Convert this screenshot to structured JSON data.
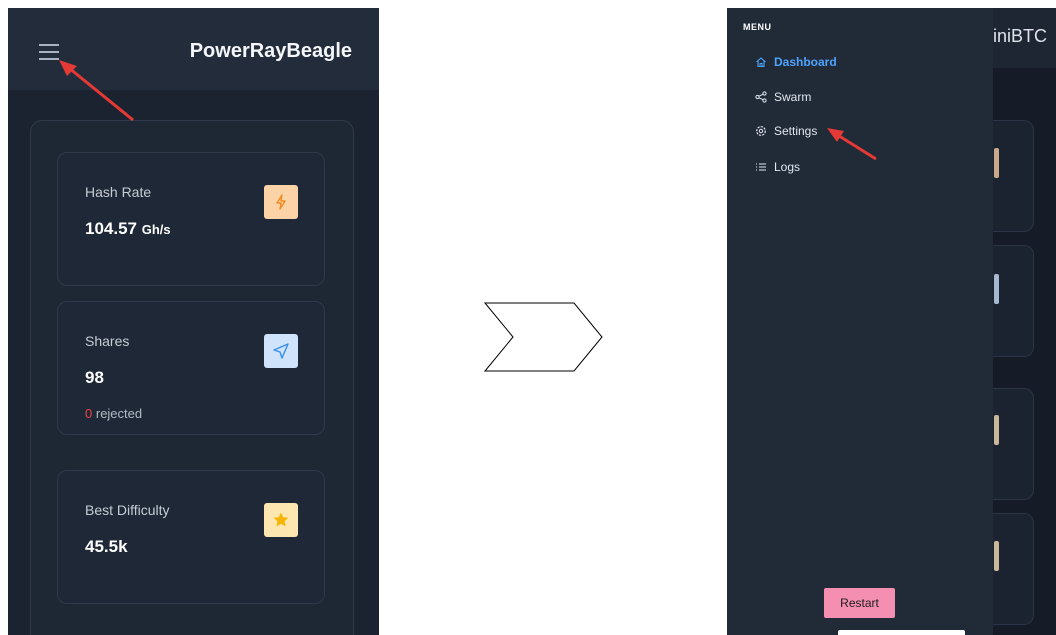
{
  "left_screen": {
    "app_title": "PowerRayBeagle",
    "cards": [
      {
        "label": "Hash Rate",
        "value": "104.57",
        "unit": "Gh/s",
        "icon": "lightning-icon"
      },
      {
        "label": "Shares",
        "value": "98",
        "rejected_count": "0",
        "rejected_label": "rejected",
        "icon": "send-icon"
      },
      {
        "label": "Best Difficulty",
        "value": "45.5k",
        "icon": "star-icon"
      }
    ]
  },
  "right_screen": {
    "menu_heading": "MENU",
    "nav_items": [
      {
        "label": "Dashboard",
        "icon": "home-icon",
        "active": true
      },
      {
        "label": "Swarm",
        "icon": "share-icon"
      },
      {
        "label": "Settings",
        "icon": "gear-icon"
      },
      {
        "label": "Logs",
        "icon": "list-icon"
      }
    ],
    "restart_label": "Restart",
    "background_title": "iniBTC"
  },
  "colors": {
    "accent_blue": "#4da3ff",
    "restart_pink": "#f48fb1",
    "rejected_red": "#ef4444",
    "annotation_arrow": "#e53935"
  }
}
